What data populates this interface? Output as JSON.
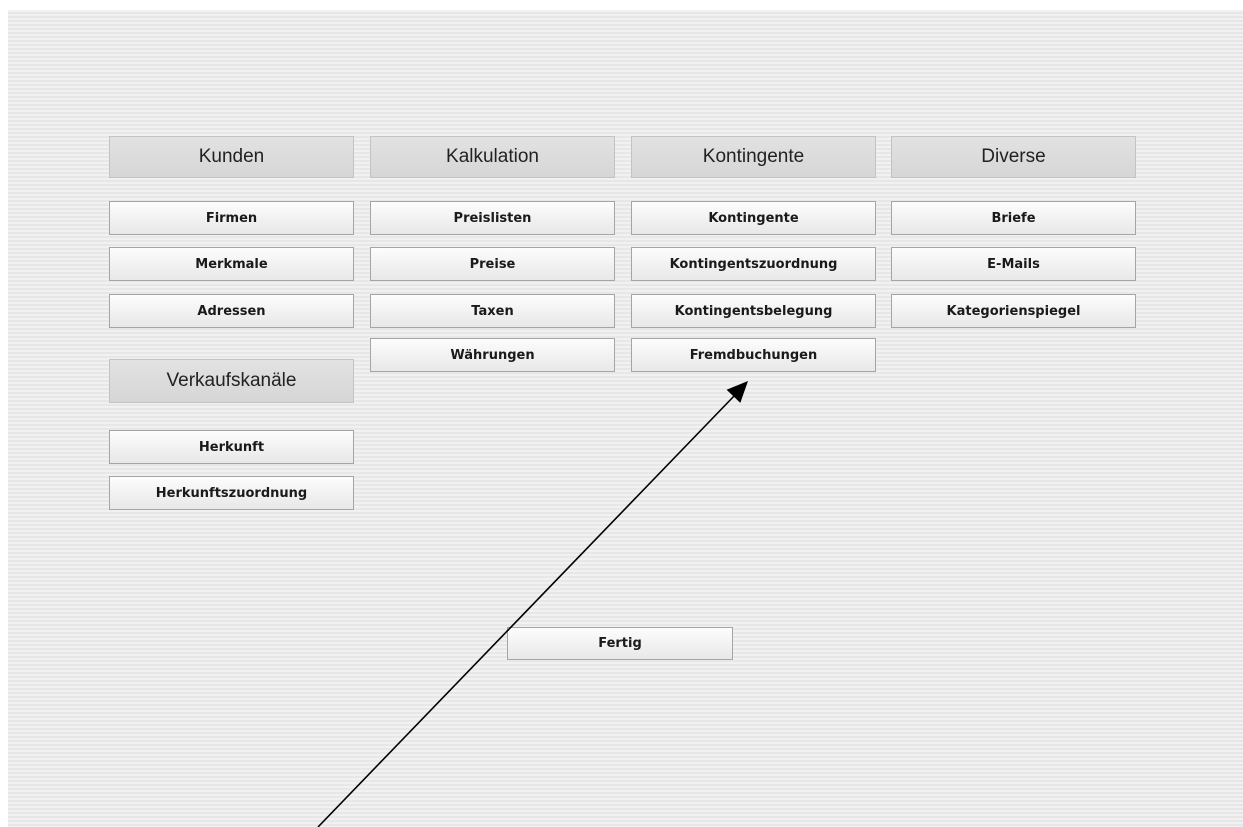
{
  "columns": {
    "kunden": {
      "header": "Kunden",
      "buttons": [
        "Firmen",
        "Merkmale",
        "Adressen"
      ]
    },
    "kalkulation": {
      "header": "Kalkulation",
      "buttons": [
        "Preislisten",
        "Preise",
        "Taxen",
        "Währungen"
      ]
    },
    "kontingente": {
      "header": "Kontingente",
      "buttons": [
        "Kontingente",
        "Kontingentszuordnung",
        "Kontingentsbelegung",
        "Fremdbuchungen"
      ]
    },
    "diverse": {
      "header": "Diverse",
      "buttons": [
        "Briefe",
        "E-Mails",
        "Kategorienspiegel"
      ]
    },
    "verkaufskanaele": {
      "header": "Verkaufskanäle",
      "buttons": [
        "Herkunft",
        "Herkunftszuordnung"
      ]
    }
  },
  "footer": {
    "done_label": "Fertig"
  },
  "colors": {
    "background_stripe_light": "#f1f1f1",
    "background_stripe_dark": "#e7e7e7",
    "header_fill": "#d9d9d9",
    "button_border": "#a5a5a5",
    "annotation_arrow": "#000000"
  },
  "icons": {
    "annotation": "arrow-pointer-icon"
  }
}
